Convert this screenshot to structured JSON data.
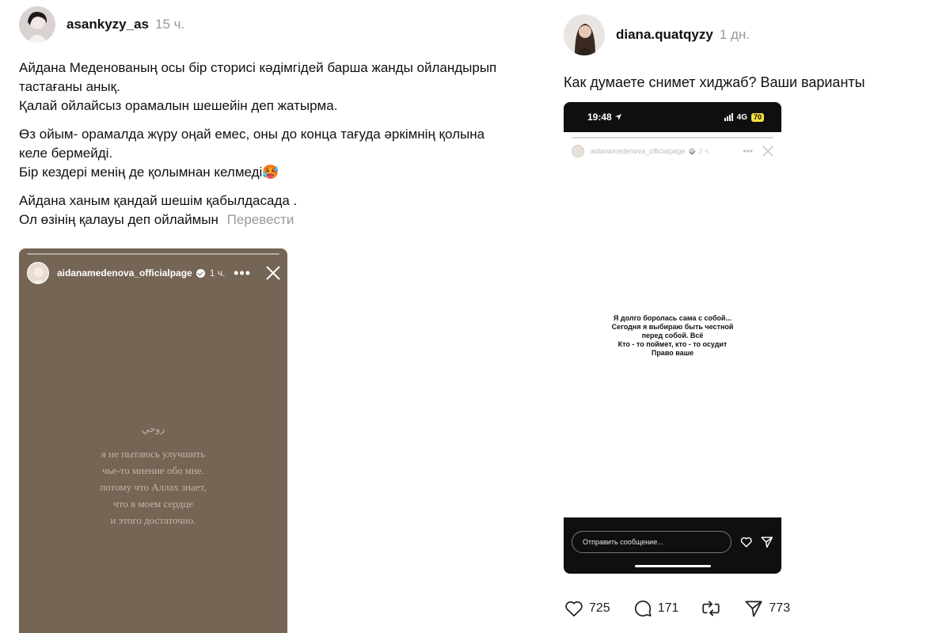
{
  "left_post": {
    "username": "asankyzy_as",
    "time": "15 ч.",
    "paragraphs": [
      [
        "Айдана Меденованың осы бір сторисі кәдімгідей барша жанды ойландырып",
        "тастағаны анық.",
        "Қалай ойлайсыз орамалын шешейін деп жатырма."
      ],
      [
        "Өз ойым- орамалда жүру оңай емес, оны до конца тағуда әркімнің қолына",
        "келе бермейді.",
        "Бір кездері менің де қолымнан келмеді🥵"
      ],
      [
        "Айдана ханым қандай шешім қабылдасада .",
        "Ол өзінің қалауы деп ойлаймын"
      ]
    ],
    "translate_label": "Перевести",
    "story": {
      "username": "aidanamedenova_officialpage",
      "time": "1 ч.",
      "arabic": "روحي",
      "quote_lines": [
        "я не пытаюсь улучшить",
        "чье-то мнение обо мне.",
        "потому что Аллах знает,",
        "что в моем сердце",
        "и этого достаточно."
      ]
    }
  },
  "right_post": {
    "username": "diana.quatqyzy",
    "time": "1 дн.",
    "caption": "Как думаете снимет хиджаб? Ваши варианты",
    "phone": {
      "clock": "19:48",
      "network": "4G",
      "battery": "70",
      "inner_username": "aidanamedenova_officialpage",
      "inner_time": "2 ч.",
      "text_lines": [
        "Я долго боролась сама с собой...",
        "Сегодня я выбираю быть честной",
        "перед собой. Всё",
        "Кто - то поймет,  кто - то осудит",
        "Право ваше"
      ],
      "reply_placeholder": "Отправить сообщение..."
    },
    "stats": {
      "likes": "725",
      "comments": "171",
      "reposts": "",
      "shares": "773"
    }
  },
  "colors": {
    "story_bg": "#746554",
    "phone_bg": "#0f0f0f",
    "muted_text": "#9a9a9a"
  }
}
